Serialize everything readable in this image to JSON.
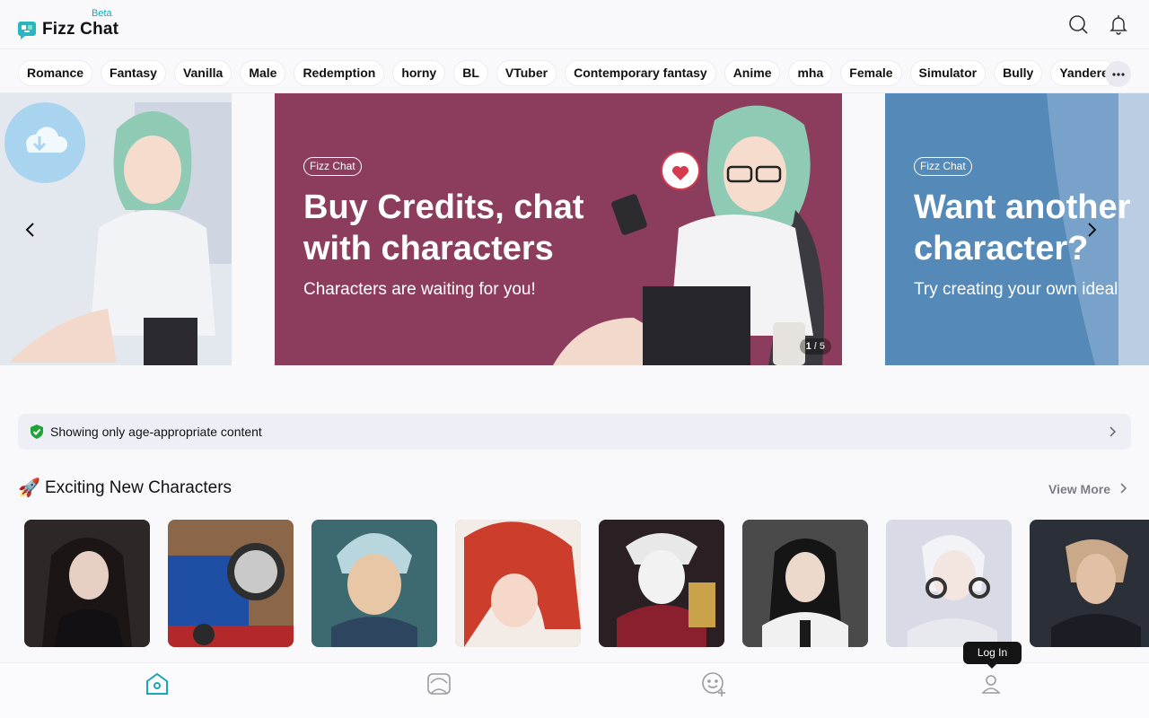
{
  "app": {
    "name": "Fizz Chat",
    "beta_label": "Beta"
  },
  "tags": [
    "Romance",
    "Fantasy",
    "Vanilla",
    "Male",
    "Redemption",
    "horny",
    "BL",
    "VTuber",
    "Contemporary fantasy",
    "Anime",
    "mha",
    "Female",
    "Simulator",
    "Bully",
    "Yandere"
  ],
  "carousel": {
    "main": {
      "badge": "Fizz Chat",
      "title_line1": "Buy Credits, chat",
      "title_line2": "with characters",
      "subtitle": "Characters are waiting for you!",
      "pager_current": "1",
      "pager_total": "/ 5"
    },
    "right": {
      "badge": "Fizz Chat",
      "title_line1": "Want another",
      "title_line2": "character?",
      "subtitle": "Try creating your own ideal"
    }
  },
  "notice": {
    "text": "Showing only age-appropriate content"
  },
  "section": {
    "icon": "🚀",
    "title": "Exciting New Characters",
    "view_more": "View More"
  },
  "bottom_nav": {
    "login_tooltip": "Log In"
  },
  "colors": {
    "brand": "#1aa6b5",
    "banner_main": "#8c3c5c",
    "banner_right": "#5589b8",
    "shield": "#22a33a"
  }
}
